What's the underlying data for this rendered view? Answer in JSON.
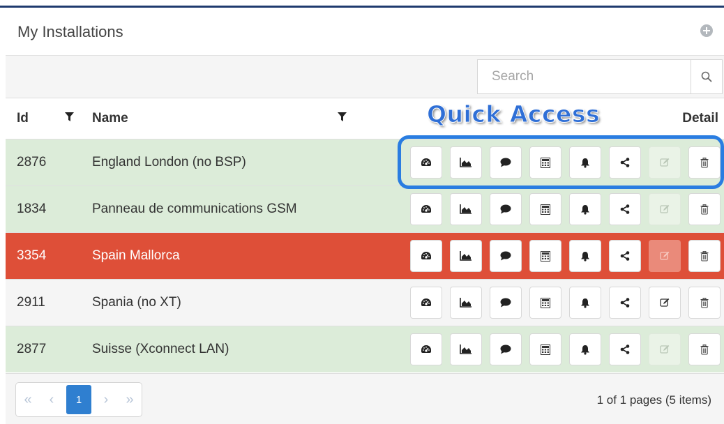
{
  "header": {
    "title": "My Installations"
  },
  "search": {
    "placeholder": "Search"
  },
  "table": {
    "columns": {
      "id": "Id",
      "name": "Name",
      "quick_access": "Quick Access",
      "detail": "Detail"
    },
    "rows": [
      {
        "id": "2876",
        "name": "England London (no BSP)",
        "status": "green",
        "edit_enabled": false
      },
      {
        "id": "1834",
        "name": "Panneau de communications GSM",
        "status": "green",
        "edit_enabled": true
      },
      {
        "id": "3354",
        "name": "Spain Mallorca",
        "status": "red",
        "edit_enabled": false
      },
      {
        "id": "2911",
        "name": "Spania (no XT)",
        "status": "white",
        "edit_enabled": true
      },
      {
        "id": "2877",
        "name": "Suisse (Xconnect LAN)",
        "status": "green",
        "edit_enabled": false
      }
    ]
  },
  "quick_access_icons": [
    "dashboard-icon",
    "chart-icon",
    "comment-icon",
    "calculator-icon",
    "bell-icon",
    "share-icon",
    "edit-icon",
    "trash-icon"
  ],
  "pagination": {
    "first": "«",
    "prev": "‹",
    "current": "1",
    "next": "›",
    "last": "»",
    "info": "1 of 1 pages (5 items)"
  },
  "colors": {
    "row_green": "#dcecd9",
    "row_red": "#de4f38",
    "accent_blue": "#2a7de1",
    "header_line": "#1f3a6e"
  }
}
